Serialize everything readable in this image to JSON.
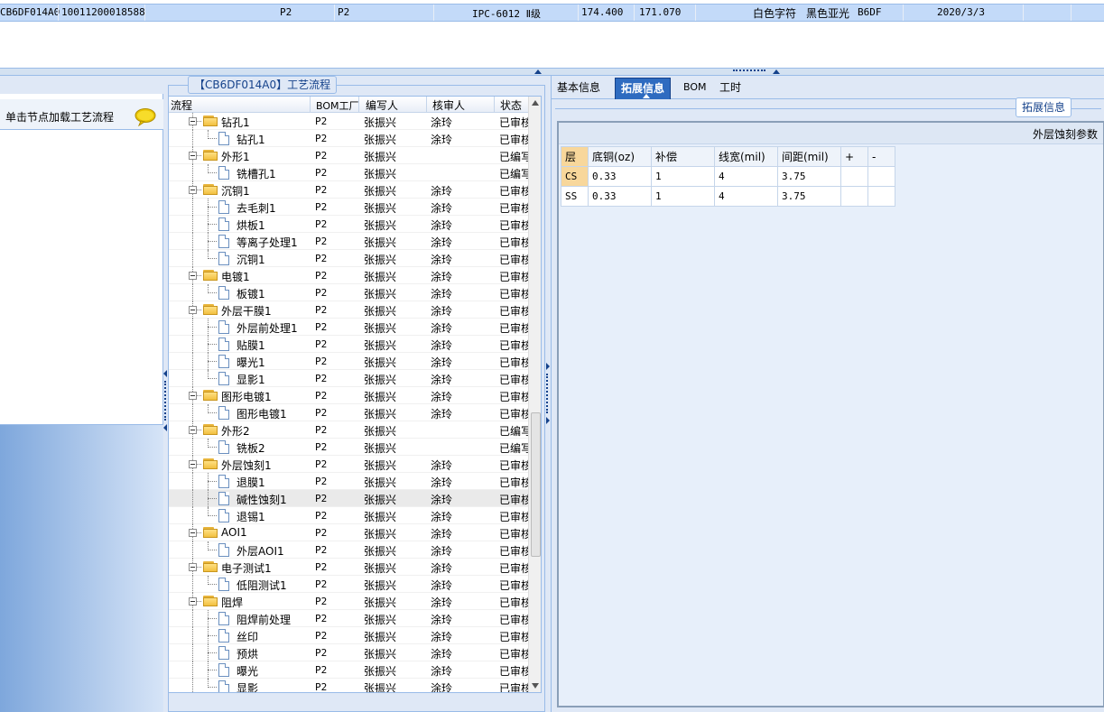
{
  "top_row": {
    "cells": [
      "CB6DF014A0",
      "10011200018588",
      "P2",
      "P2",
      "IPC-6012 Ⅱ级",
      "174.400",
      "171.070",
      "白色字符",
      "黑色亚光",
      "B6DF",
      "2020/3/3"
    ]
  },
  "left_panel": {
    "hint": "单击节点加载工艺流程",
    "bubble_icon": "speech-bubble-icon"
  },
  "process_panel": {
    "title": "【CB6DF014A0】工艺流程",
    "columns": [
      "流程",
      "BOM工厂",
      "编写人",
      "核审人",
      "状态"
    ],
    "rows": [
      {
        "name": "钻孔1",
        "level": 0,
        "bom": "P2",
        "writer": "张振兴",
        "reviewer": "涂玲",
        "status": "已审核"
      },
      {
        "name": "钻孔1",
        "level": 1,
        "bom": "P2",
        "writer": "张振兴",
        "reviewer": "涂玲",
        "status": "已审核"
      },
      {
        "name": "外形1",
        "level": 0,
        "bom": "P2",
        "writer": "张振兴",
        "reviewer": "",
        "status": "已编写"
      },
      {
        "name": "铣槽孔1",
        "level": 1,
        "bom": "P2",
        "writer": "张振兴",
        "reviewer": "",
        "status": "已编写"
      },
      {
        "name": "沉铜1",
        "level": 0,
        "bom": "P2",
        "writer": "张振兴",
        "reviewer": "涂玲",
        "status": "已审核"
      },
      {
        "name": "去毛刺1",
        "level": 1,
        "bom": "P2",
        "writer": "张振兴",
        "reviewer": "涂玲",
        "status": "已审核"
      },
      {
        "name": "烘板1",
        "level": 1,
        "bom": "P2",
        "writer": "张振兴",
        "reviewer": "涂玲",
        "status": "已审核"
      },
      {
        "name": "等离子处理1",
        "level": 1,
        "bom": "P2",
        "writer": "张振兴",
        "reviewer": "涂玲",
        "status": "已审核"
      },
      {
        "name": "沉铜1",
        "level": 1,
        "bom": "P2",
        "writer": "张振兴",
        "reviewer": "涂玲",
        "status": "已审核"
      },
      {
        "name": "电镀1",
        "level": 0,
        "bom": "P2",
        "writer": "张振兴",
        "reviewer": "涂玲",
        "status": "已审核"
      },
      {
        "name": "板镀1",
        "level": 1,
        "bom": "P2",
        "writer": "张振兴",
        "reviewer": "涂玲",
        "status": "已审核"
      },
      {
        "name": "外层干膜1",
        "level": 0,
        "bom": "P2",
        "writer": "张振兴",
        "reviewer": "涂玲",
        "status": "已审核"
      },
      {
        "name": "外层前处理1",
        "level": 1,
        "bom": "P2",
        "writer": "张振兴",
        "reviewer": "涂玲",
        "status": "已审核"
      },
      {
        "name": "贴膜1",
        "level": 1,
        "bom": "P2",
        "writer": "张振兴",
        "reviewer": "涂玲",
        "status": "已审核"
      },
      {
        "name": "曝光1",
        "level": 1,
        "bom": "P2",
        "writer": "张振兴",
        "reviewer": "涂玲",
        "status": "已审核"
      },
      {
        "name": "显影1",
        "level": 1,
        "bom": "P2",
        "writer": "张振兴",
        "reviewer": "涂玲",
        "status": "已审核"
      },
      {
        "name": "图形电镀1",
        "level": 0,
        "bom": "P2",
        "writer": "张振兴",
        "reviewer": "涂玲",
        "status": "已审核"
      },
      {
        "name": "图形电镀1",
        "level": 1,
        "bom": "P2",
        "writer": "张振兴",
        "reviewer": "涂玲",
        "status": "已审核"
      },
      {
        "name": "外形2",
        "level": 0,
        "bom": "P2",
        "writer": "张振兴",
        "reviewer": "",
        "status": "已编写"
      },
      {
        "name": "铣板2",
        "level": 1,
        "bom": "P2",
        "writer": "张振兴",
        "reviewer": "",
        "status": "已编写"
      },
      {
        "name": "外层蚀刻1",
        "level": 0,
        "bom": "P2",
        "writer": "张振兴",
        "reviewer": "涂玲",
        "status": "已审核"
      },
      {
        "name": "退膜1",
        "level": 1,
        "bom": "P2",
        "writer": "张振兴",
        "reviewer": "涂玲",
        "status": "已审核"
      },
      {
        "name": "碱性蚀刻1",
        "level": 1,
        "bom": "P2",
        "writer": "张振兴",
        "reviewer": "涂玲",
        "status": "已审核",
        "selected": true
      },
      {
        "name": "退锡1",
        "level": 1,
        "bom": "P2",
        "writer": "张振兴",
        "reviewer": "涂玲",
        "status": "已审核"
      },
      {
        "name": "AOI1",
        "level": 0,
        "bom": "P2",
        "writer": "张振兴",
        "reviewer": "涂玲",
        "status": "已审核"
      },
      {
        "name": "外层AOI1",
        "level": 1,
        "bom": "P2",
        "writer": "张振兴",
        "reviewer": "涂玲",
        "status": "已审核"
      },
      {
        "name": "电子测试1",
        "level": 0,
        "bom": "P2",
        "writer": "张振兴",
        "reviewer": "涂玲",
        "status": "已审核"
      },
      {
        "name": "低阻测试1",
        "level": 1,
        "bom": "P2",
        "writer": "张振兴",
        "reviewer": "涂玲",
        "status": "已审核"
      },
      {
        "name": "阻焊",
        "level": 0,
        "bom": "P2",
        "writer": "张振兴",
        "reviewer": "涂玲",
        "status": "已审核"
      },
      {
        "name": "阻焊前处理",
        "level": 1,
        "bom": "P2",
        "writer": "张振兴",
        "reviewer": "涂玲",
        "status": "已审核"
      },
      {
        "name": "丝印",
        "level": 1,
        "bom": "P2",
        "writer": "张振兴",
        "reviewer": "涂玲",
        "status": "已审核"
      },
      {
        "name": "预烘",
        "level": 1,
        "bom": "P2",
        "writer": "张振兴",
        "reviewer": "涂玲",
        "status": "已审核"
      },
      {
        "name": "曝光",
        "level": 1,
        "bom": "P2",
        "writer": "张振兴",
        "reviewer": "涂玲",
        "status": "已审核"
      },
      {
        "name": "显影",
        "level": 1,
        "bom": "P2",
        "writer": "张振兴",
        "reviewer": "涂玲",
        "status": "已审核"
      }
    ]
  },
  "right_panel": {
    "tabs": [
      {
        "label": "基本信息",
        "active": false
      },
      {
        "label": "拓展信息",
        "active": true
      },
      {
        "label": "BOM",
        "active": false
      },
      {
        "label": "工时",
        "active": false
      }
    ],
    "fieldset_legend": "拓展信息",
    "section_title": "外层蚀刻参数",
    "param_columns": [
      "层",
      "底铜(oz)",
      "补偿",
      "线宽(mil)",
      "间距(mil)",
      "+",
      "-"
    ],
    "param_rows": [
      {
        "layer": "CS",
        "base_copper": "0.33",
        "comp": "1",
        "width": "4",
        "spacing": "3.75"
      },
      {
        "layer": "SS",
        "base_copper": "0.33",
        "comp": "1",
        "width": "4",
        "spacing": "3.75"
      }
    ]
  },
  "colors": {
    "selected_row": "#c3daf9",
    "active_tab": "#2e6bc0",
    "panel_border": "#99bbe8"
  }
}
